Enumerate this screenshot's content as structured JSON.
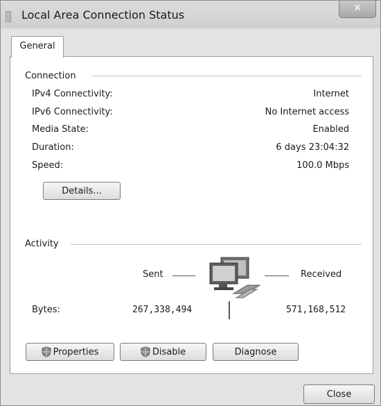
{
  "window": {
    "title": "Local Area Connection Status",
    "close_glyph": "✕"
  },
  "tabs": [
    {
      "label": "General"
    }
  ],
  "connection": {
    "heading": "Connection",
    "rows": [
      {
        "label": "IPv4 Connectivity:",
        "value": "Internet"
      },
      {
        "label": "IPv6 Connectivity:",
        "value": "No Internet access"
      },
      {
        "label": "Media State:",
        "value": "Enabled"
      },
      {
        "label": "Duration:",
        "value": "6 days 23:04:32"
      },
      {
        "label": "Speed:",
        "value": "100.0 Mbps"
      }
    ],
    "details_button": "Details..."
  },
  "activity": {
    "heading": "Activity",
    "sent_label": "Sent",
    "received_label": "Received",
    "bytes_label": "Bytes:",
    "bytes_sent": "267,338,494",
    "bytes_received": "571,168,512"
  },
  "buttons": {
    "properties": "Properties",
    "disable": "Disable",
    "diagnose": "Diagnose",
    "close": "Close"
  }
}
